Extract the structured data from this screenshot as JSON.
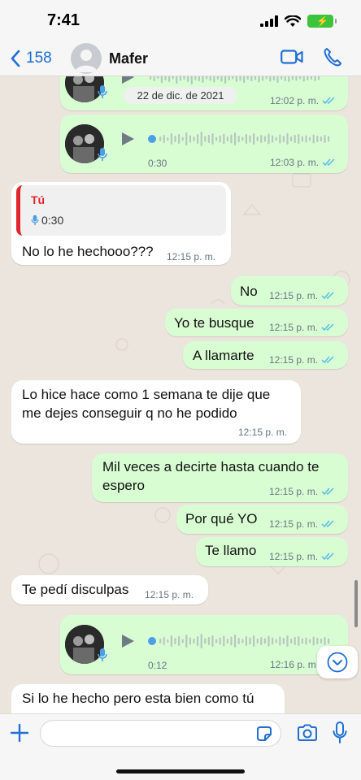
{
  "status_bar": {
    "time": "7:41"
  },
  "header": {
    "back_count": "158",
    "contact_name": "Mafer"
  },
  "date_separator": "22 de dic. de 2021",
  "messages": [
    {
      "kind": "voice",
      "direction": "out",
      "duration": "",
      "time": "12:02 p. m.",
      "status": "read"
    },
    {
      "kind": "voice",
      "direction": "out",
      "duration": "0:30",
      "time": "12:03 p. m.",
      "status": "read"
    },
    {
      "kind": "reply_text",
      "direction": "in",
      "reply_author": "Tú",
      "reply_duration": "0:30",
      "text": "No lo he hechooo???",
      "time": "12:15 p. m."
    },
    {
      "kind": "text",
      "direction": "out",
      "text": "No",
      "time": "12:15 p. m.",
      "status": "read"
    },
    {
      "kind": "text",
      "direction": "out",
      "text": "Yo te busque",
      "time": "12:15 p. m.",
      "status": "read"
    },
    {
      "kind": "text",
      "direction": "out",
      "text": "A llamarte",
      "time": "12:15 p. m.",
      "status": "read"
    },
    {
      "kind": "text",
      "direction": "in",
      "lines": [
        "Lo hice hace como 1 semana te dije que",
        "me dejes conseguir q no he podido"
      ],
      "time": "12:15 p. m."
    },
    {
      "kind": "text",
      "direction": "out",
      "lines": [
        "Mil veces a decirte hasta cuando te",
        "espero"
      ],
      "time": "12:15 p. m.",
      "status": "read"
    },
    {
      "kind": "text",
      "direction": "out",
      "text": "Por qué YO",
      "time": "12:15 p. m.",
      "status": "read"
    },
    {
      "kind": "text",
      "direction": "out",
      "text": "Te llamo",
      "time": "12:15 p. m.",
      "status": "read"
    },
    {
      "kind": "text",
      "direction": "in",
      "text": "Te pedí disculpas",
      "time": "12:15 p. m."
    },
    {
      "kind": "voice",
      "direction": "out",
      "duration": "0:12",
      "time": "12:16 p. m",
      "status": "read"
    },
    {
      "kind": "text",
      "direction": "in",
      "text": "Si lo he hecho pero esta bien como tú",
      "time": ""
    }
  ],
  "composer": {
    "placeholder": "",
    "value": ""
  },
  "icons": {
    "back": "chevron-left-icon",
    "video": "video-camera-icon",
    "call": "phone-icon",
    "play": "play-icon",
    "mic": "microphone-icon",
    "plus": "plus-icon",
    "sticker": "sticker-icon",
    "camera": "camera-icon",
    "scroll_down": "chevron-down-icon"
  },
  "colors": {
    "accent": "#1f6fd6",
    "outgoing_bubble": "#d9fdd3",
    "incoming_bubble": "#ffffff",
    "read_ticks": "#53bdeb",
    "reply_author": "#e0262a",
    "battery": "#3cc43c"
  }
}
